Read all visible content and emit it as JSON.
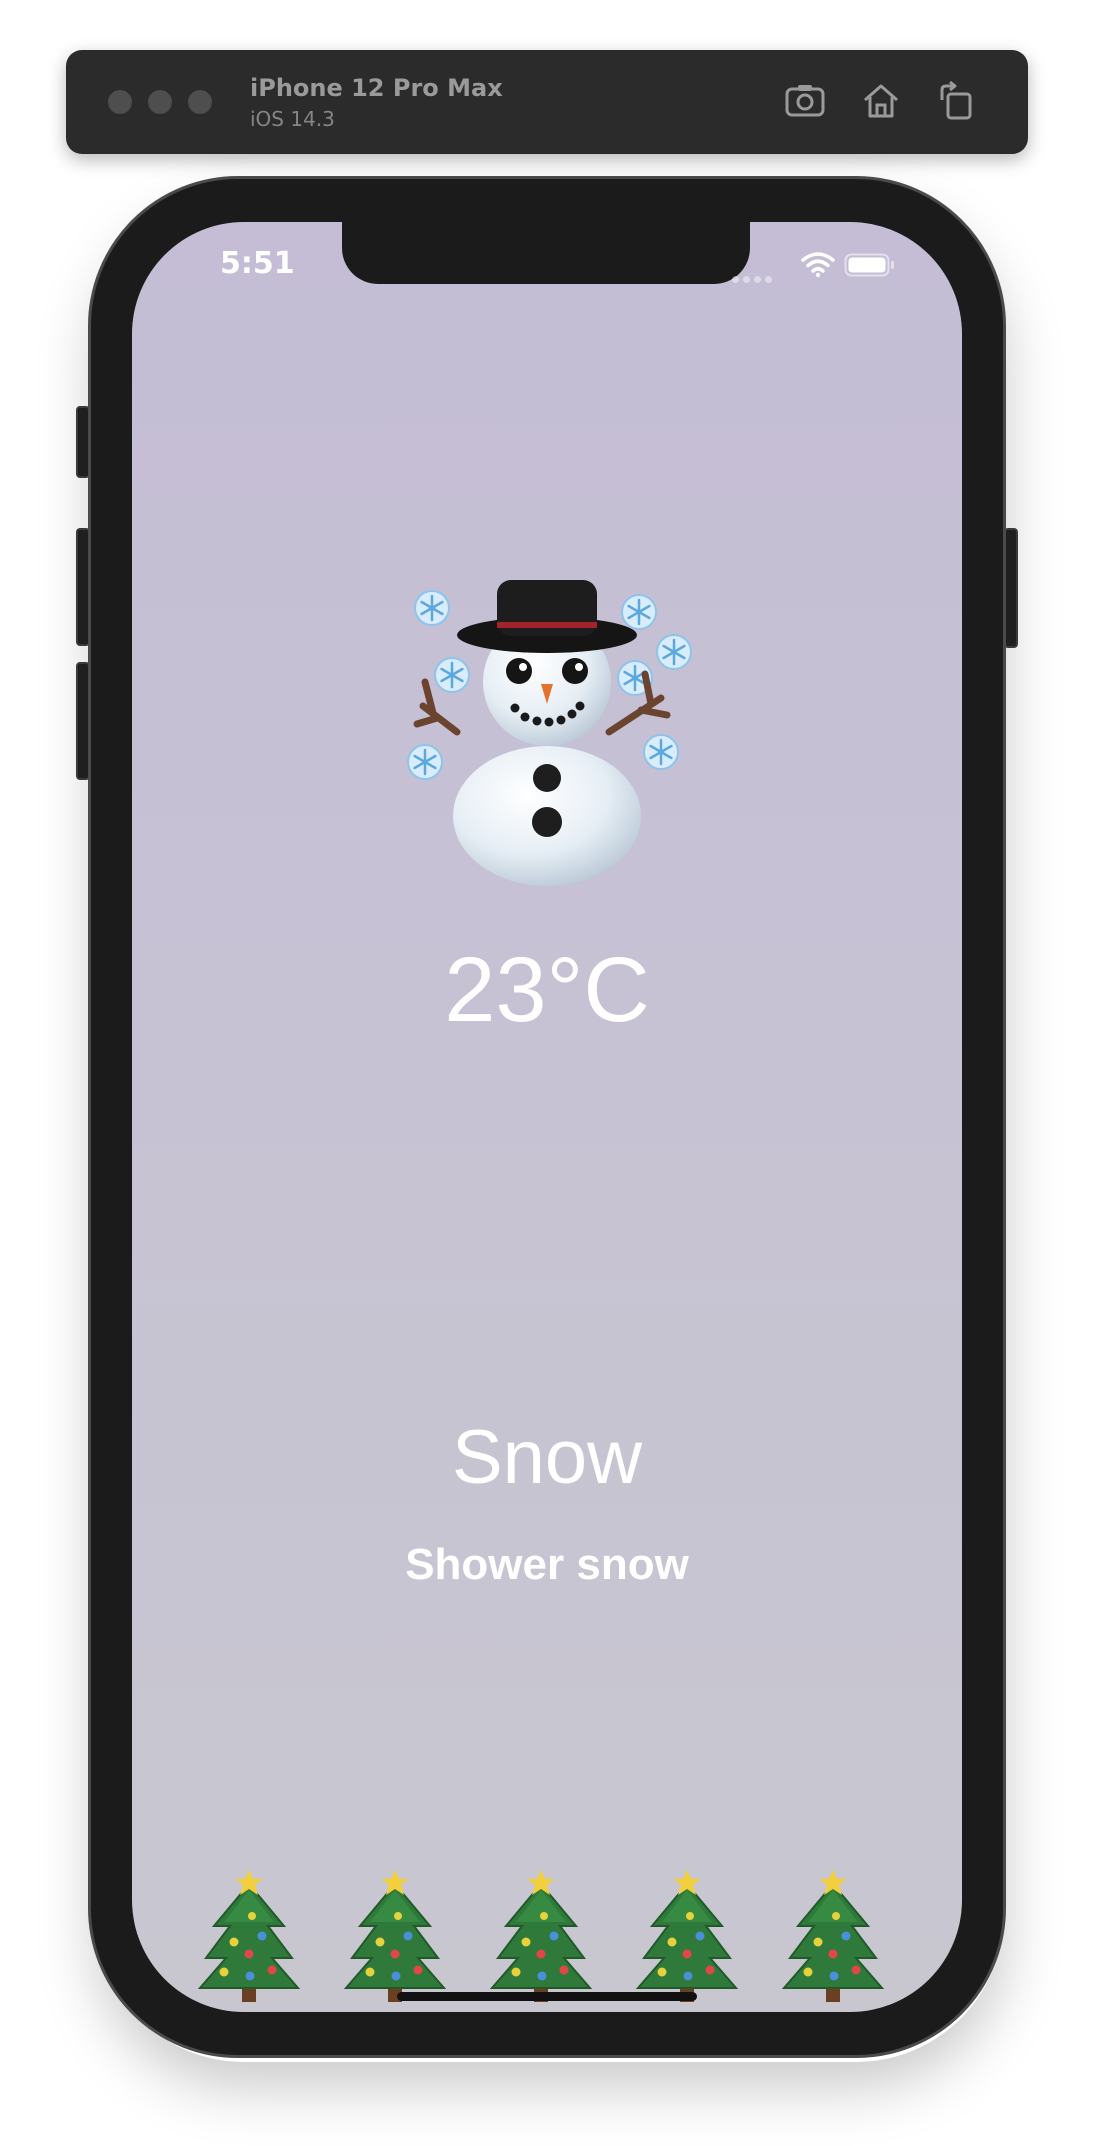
{
  "simulator": {
    "device_name": "iPhone 12 Pro Max",
    "os_version": "iOS 14.3",
    "toolbar_buttons": [
      "screenshot-icon",
      "home-icon",
      "rotate-icon"
    ]
  },
  "status_bar": {
    "time": "5:51",
    "icons": [
      "signal-icon",
      "wifi-icon",
      "battery-icon"
    ]
  },
  "weather": {
    "icon": "snowman-with-snowflakes-icon",
    "temperature": "23°C",
    "condition": "Snow",
    "description": "Shower snow"
  },
  "decorations": {
    "icon": "christmas-tree-icon",
    "count": 5
  },
  "colors": {
    "background_top": "#c4bdd5",
    "background_bottom": "#c8c7d0",
    "text": "#ffffff"
  }
}
